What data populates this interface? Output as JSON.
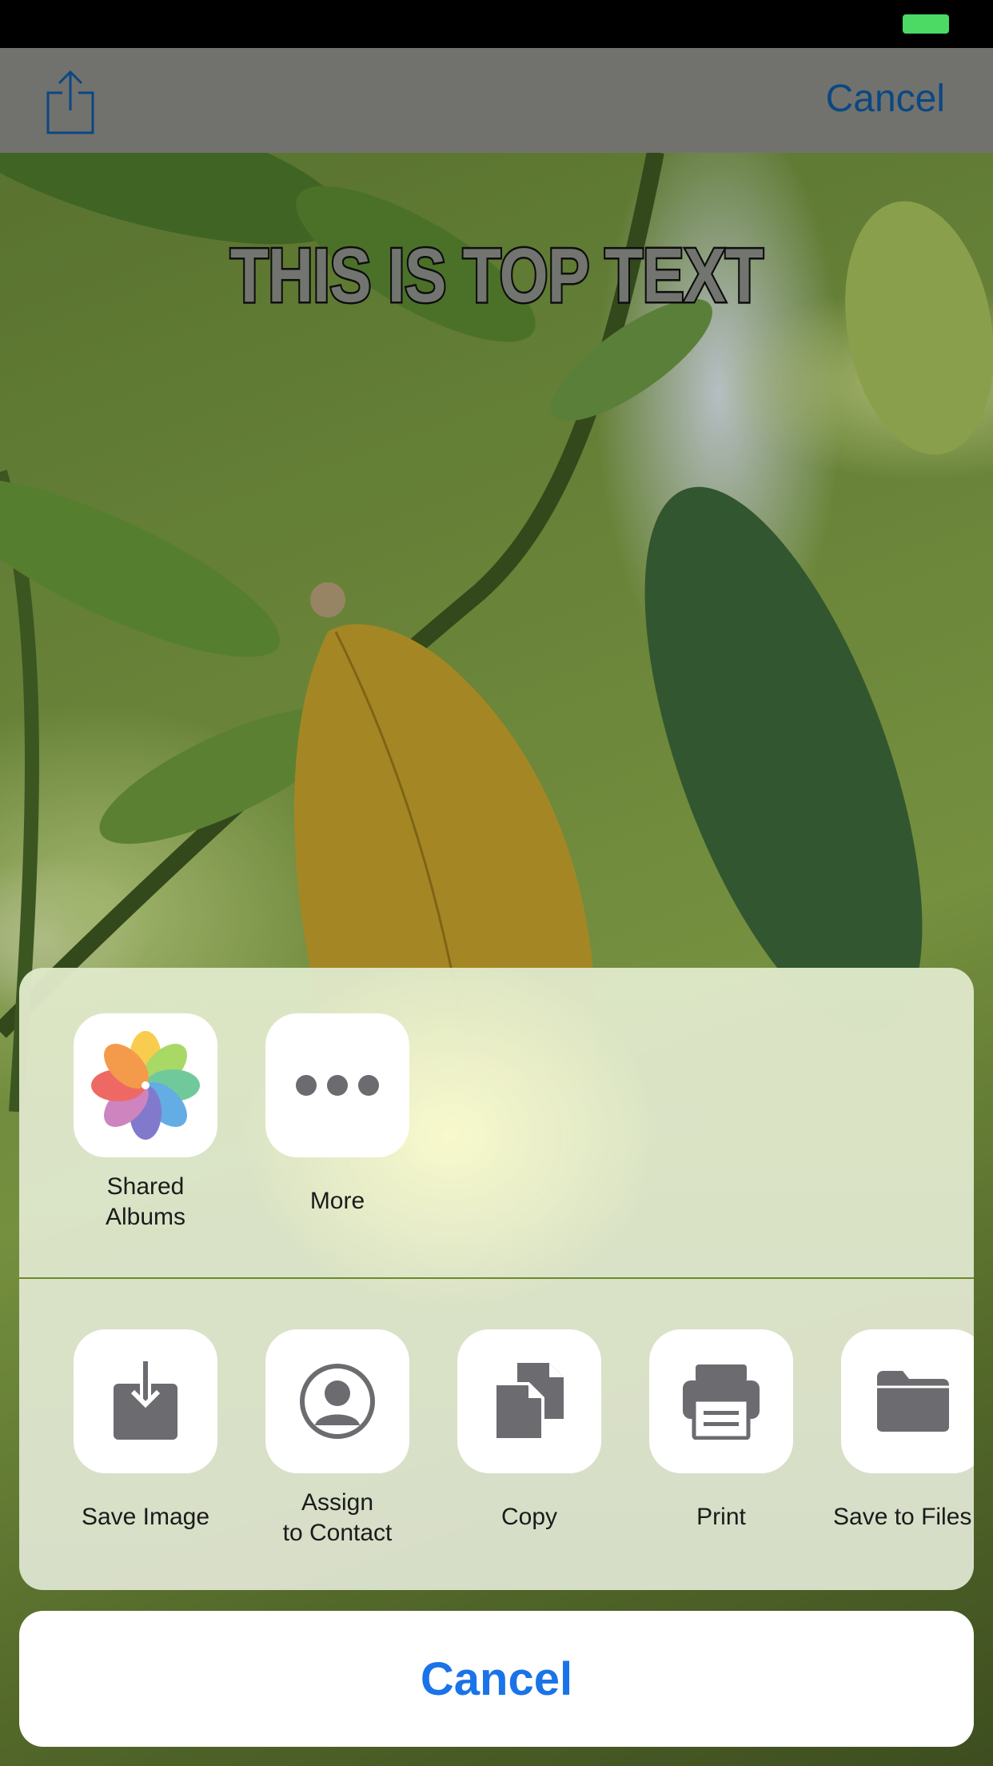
{
  "status_bar": {
    "battery_color": "#4cd964"
  },
  "navbar": {
    "share_icon": "share-icon",
    "cancel_label": "Cancel"
  },
  "meme": {
    "top_text": "THIS IS TOP TEXT"
  },
  "share_sheet": {
    "apps": [
      {
        "icon": "photos-icon",
        "label": "Shared\nAlbums"
      },
      {
        "icon": "more-icon",
        "label": "More"
      }
    ],
    "actions": [
      {
        "icon": "save-image-icon",
        "label": "Save Image"
      },
      {
        "icon": "contact-icon",
        "label": "Assign\nto Contact"
      },
      {
        "icon": "copy-icon",
        "label": "Copy"
      },
      {
        "icon": "print-icon",
        "label": "Print"
      },
      {
        "icon": "folder-icon",
        "label": "Save to Files"
      }
    ],
    "cancel_label": "Cancel"
  },
  "colors": {
    "accent": "#1a73e8",
    "nav_accent": "#0f57a0",
    "icon_gray": "#6b6b70"
  }
}
